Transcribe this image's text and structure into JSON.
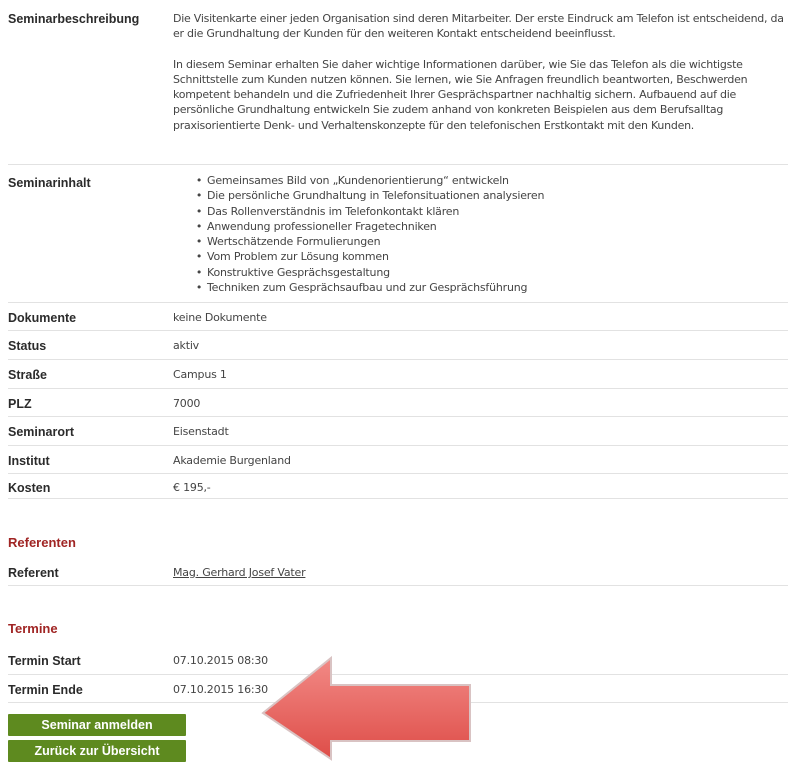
{
  "details": {
    "description": {
      "label": "Seminarbeschreibung",
      "paragraph1": "Die Visitenkarte einer jeden Organisation sind deren Mitarbeiter. Der erste Eindruck am Telefon ist entscheidend, da er die Grundhaltung der Kunden für den weiteren Kontakt entscheidend beeinflusst.",
      "paragraph2": "In diesem Seminar erhalten Sie daher wichtige Informationen darüber, wie Sie das Telefon als die wichtigste Schnittstelle zum Kunden nutzen können. Sie lernen, wie Sie Anfragen freundlich beantworten, Beschwerden kompetent behandeln und die Zufriedenheit Ihrer Gesprächspartner nachhaltig sichern. Aufbauend auf die persönliche Grundhaltung entwickeln Sie zudem anhand von konkreten Beispielen aus dem Berufsalltag praxisorientierte Denk- und Verhaltenskonzepte für den telefonischen Erstkontakt mit den Kunden."
    },
    "content": {
      "label": "Seminarinhalt",
      "items": [
        "Gemeinsames Bild von „Kundenorientierung“ entwickeln",
        "Die persönliche Grundhaltung in Telefonsituationen analysieren",
        "Das Rollenverständnis im Telefonkontakt klären",
        "Anwendung professioneller Fragetechniken",
        "Wertschätzende Formulierungen",
        "Vom Problem zur Lösung kommen",
        "Konstruktive Gesprächsgestaltung",
        "Techniken zum Gesprächsaufbau und zur Gesprächsführung"
      ]
    },
    "rows": [
      {
        "label": "Dokumente",
        "value": "keine Dokumente"
      },
      {
        "label": "Status",
        "value": "aktiv"
      },
      {
        "label": "Straße",
        "value": "Campus 1"
      },
      {
        "label": "PLZ",
        "value": "7000"
      },
      {
        "label": "Seminarort",
        "value": "Eisenstadt"
      },
      {
        "label": "Institut",
        "value": "Akademie Burgenland"
      },
      {
        "label": "Kosten",
        "value": "€ 195,-"
      }
    ]
  },
  "referenten": {
    "heading": "Referenten",
    "label": "Referent",
    "name": "Mag. Gerhard Josef Vater"
  },
  "termine": {
    "heading": "Termine",
    "start_label": "Termin Start",
    "start_value": "07.10.2015 08:30",
    "end_label": "Termin Ende",
    "end_value": "07.10.2015 16:30"
  },
  "buttons": {
    "register": "Seminar anmelden",
    "back": "Zurück zur Übersicht"
  },
  "colors": {
    "section_heading": "#a02524",
    "button_bg": "#5e8a1f",
    "arrow_fill": "#e8615c"
  }
}
